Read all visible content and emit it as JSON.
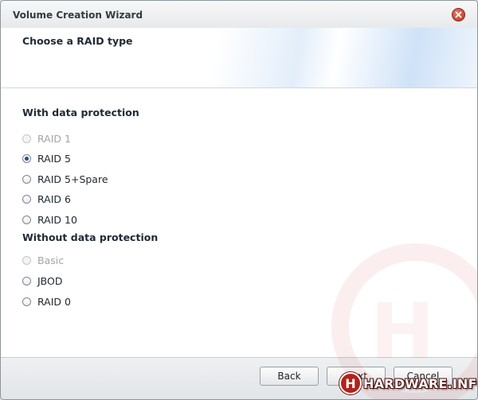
{
  "window": {
    "title": "Volume Creation Wizard"
  },
  "header": {
    "title": "Choose a RAID type"
  },
  "sections": [
    {
      "heading": "With data protection",
      "options": [
        {
          "label": "RAID 1",
          "selected": false,
          "disabled": true
        },
        {
          "label": "RAID 5",
          "selected": true,
          "disabled": false
        },
        {
          "label": "RAID 5+Spare",
          "selected": false,
          "disabled": false
        },
        {
          "label": "RAID 6",
          "selected": false,
          "disabled": false
        },
        {
          "label": "RAID 10",
          "selected": false,
          "disabled": false
        }
      ]
    },
    {
      "heading": "Without data protection",
      "options": [
        {
          "label": "Basic",
          "selected": false,
          "disabled": true
        },
        {
          "label": "JBOD",
          "selected": false,
          "disabled": false
        },
        {
          "label": "RAID 0",
          "selected": false,
          "disabled": false
        }
      ]
    }
  ],
  "footer": {
    "back_label": "Back",
    "next_label": "Next",
    "cancel_label": "Cancel"
  },
  "watermark": {
    "text": "HARDWARE.INFO",
    "logo_letter": "H"
  },
  "icons": {
    "close": "close-icon"
  },
  "colors": {
    "close_button": "#c4412b",
    "selected_radio": "#1f4f8f",
    "watermark_red": "#b3221c"
  }
}
